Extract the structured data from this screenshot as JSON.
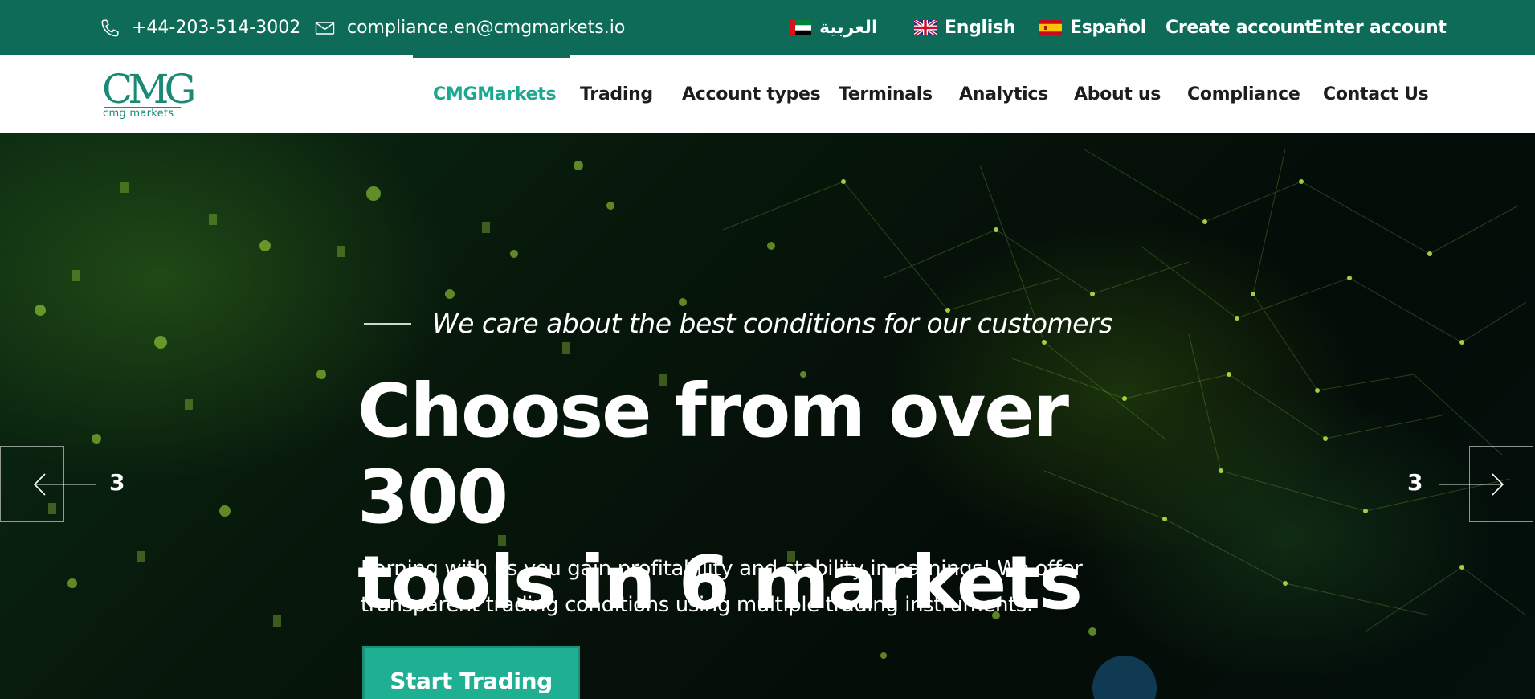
{
  "topbar": {
    "phone": "+44-203-514-3002",
    "email": "compliance.en@cmgmarkets.io",
    "languages": [
      {
        "label": "العربية",
        "flag": "uae-flag"
      },
      {
        "label": "English",
        "flag": "uk-flag"
      },
      {
        "label": "Español",
        "flag": "spain-flag"
      }
    ],
    "create_account": "Create account",
    "enter_account": "Enter account"
  },
  "logo": {
    "letters": "CMG",
    "sub": "cmg markets"
  },
  "nav": {
    "items": [
      {
        "label": "CMGMarkets",
        "active": true
      },
      {
        "label": "Trading"
      },
      {
        "label": "Account types"
      },
      {
        "label": "Terminals"
      },
      {
        "label": "Analytics"
      },
      {
        "label": "About us"
      },
      {
        "label": "Compliance"
      },
      {
        "label": "Contact Us"
      }
    ]
  },
  "hero": {
    "tagline": "We care about the best conditions for our customers",
    "title_line1": "Choose from over 300",
    "title_line2": "tools in 6 markets",
    "description_line1": "Earning with us you gain profitability and stability in earnings! We offer",
    "description_line2": "transparent trading conditions using multiple trading instruments.",
    "cta": "Start Trading",
    "prev_slide_num": "3",
    "next_slide_num": "3"
  },
  "colors": {
    "brand_dark_green": "#0e6b57",
    "brand_teal": "#1ba88e",
    "cta": "#1fb094"
  }
}
